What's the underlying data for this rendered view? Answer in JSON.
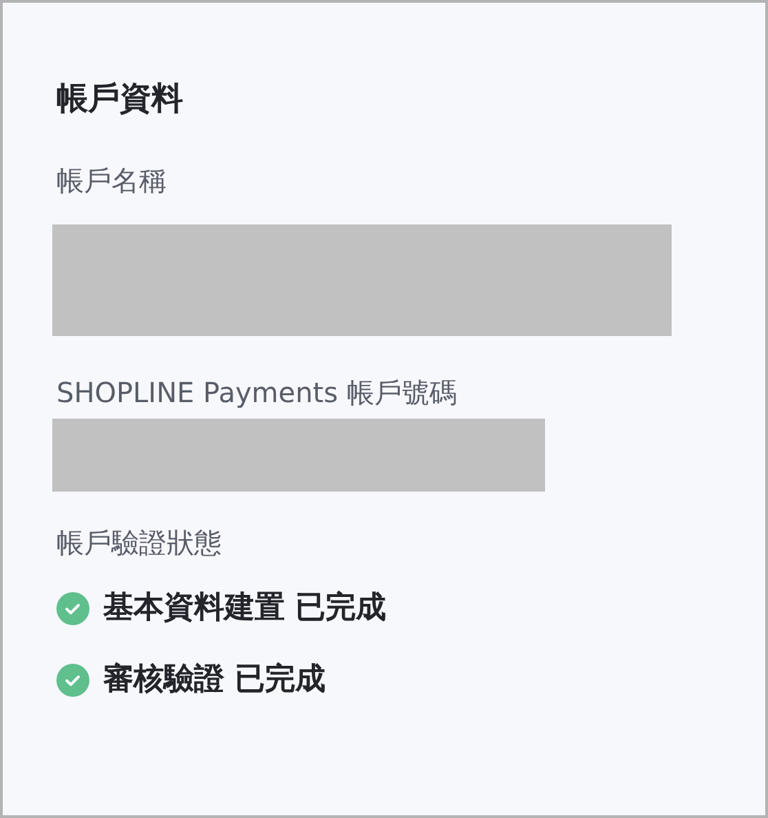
{
  "title": "帳戶資料",
  "fields": [
    {
      "label": "帳戶名稱",
      "redacted": true
    },
    {
      "label": "SHOPLINE Payments 帳戶號碼",
      "redacted": true
    }
  ],
  "verification": {
    "label": "帳戶驗證狀態",
    "items": [
      {
        "text": "基本資料建置 已完成",
        "done": true
      },
      {
        "text": "審核驗證 已完成",
        "done": true
      }
    ]
  }
}
